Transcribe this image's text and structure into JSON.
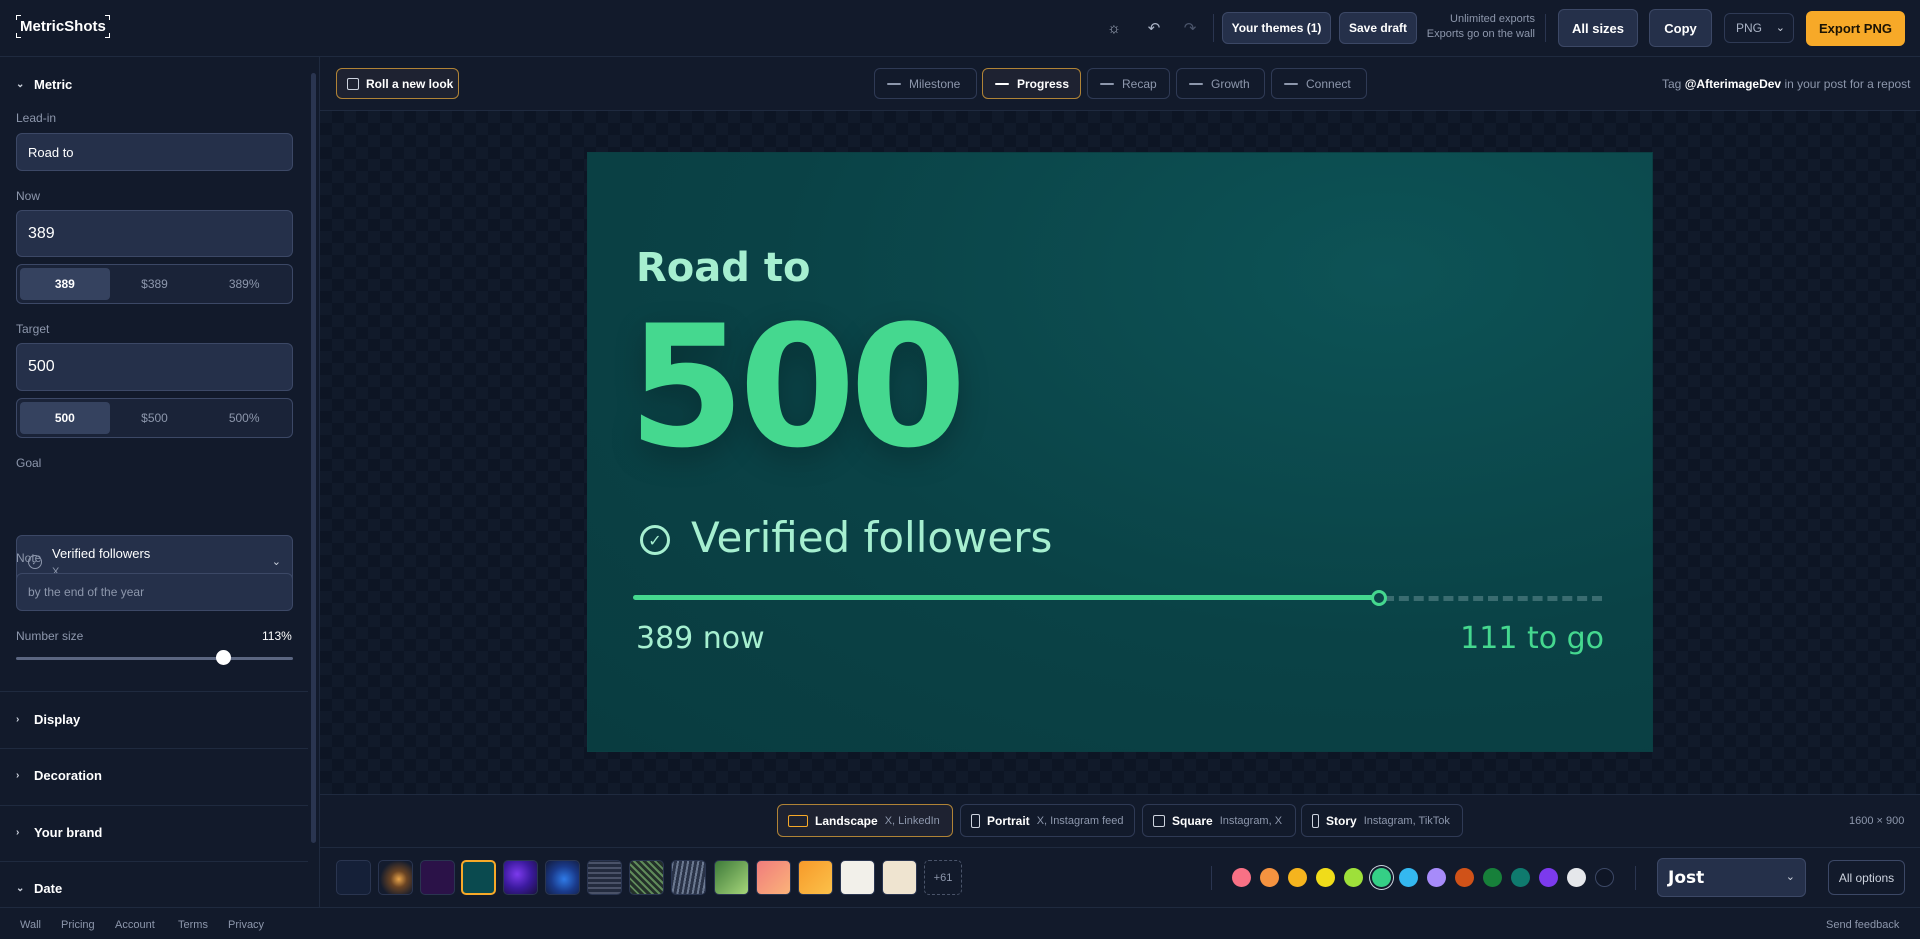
{
  "app": {
    "name": "MetricShots"
  },
  "topbar": {
    "your_themes": "Your themes (1)",
    "save_draft": "Save draft",
    "note_line1": "Unlimited exports",
    "note_line2": "Exports go on the wall",
    "all_sizes": "All sizes",
    "copy": "Copy",
    "format": "PNG",
    "export": "Export PNG"
  },
  "sidebar": {
    "metric_section": "Metric",
    "lead_in_label": "Lead-in",
    "lead_in_value": "Road to",
    "now_label": "Now",
    "now_value": "389",
    "now_formats": [
      "389",
      "$389",
      "389%"
    ],
    "target_label": "Target",
    "target_value": "500",
    "target_formats": [
      "500",
      "$500",
      "500%"
    ],
    "goal_label": "Goal",
    "goal_value": "Verified followers",
    "goal_platform": "X",
    "note_label": "Note",
    "note_placeholder": "by the end of the year",
    "number_size_label": "Number size",
    "number_size_value": "113%",
    "number_size_level": 0.74,
    "sections": [
      "Display",
      "Decoration",
      "Your brand",
      "Date"
    ]
  },
  "toolbar": {
    "roll": "Roll a new look",
    "topics": [
      "Milestone",
      "Progress",
      "Recap",
      "Growth",
      "Connect"
    ],
    "active_topic": "Progress",
    "tag_prefix": "Tag",
    "tag_handle": "@AfterimageDev",
    "tag_suffix": "in your post for a repost"
  },
  "card": {
    "lead": "Road to",
    "target": "500",
    "goal": "Verified followers",
    "now_text": "389 now",
    "togo_text": "111 to go",
    "progress": 0.778
  },
  "sizes": [
    {
      "name": "Landscape",
      "platforms": "X, LinkedIn"
    },
    {
      "name": "Portrait",
      "platforms": "X, Instagram feed"
    },
    {
      "name": "Square",
      "platforms": "Instagram, X"
    },
    {
      "name": "Story",
      "platforms": "Instagram, TikTok"
    }
  ],
  "dimensions": "1600 × 900",
  "more_themes": "+61",
  "accent_colors": [
    "#f87185",
    "#f59340",
    "#f5b41e",
    "#f0dc1a",
    "#9ee03a",
    "#35cf86",
    "#34b8f0",
    "#a78bfa",
    "#d05218",
    "#17803a",
    "#0f7a6e",
    "#7c3aed",
    "#e5e7eb",
    "#0f1626"
  ],
  "font": "Jost",
  "all_options": "All options",
  "footer": {
    "links": [
      "Wall",
      "Pricing",
      "Account",
      "Terms",
      "Privacy"
    ],
    "feedback": "Send feedback"
  }
}
